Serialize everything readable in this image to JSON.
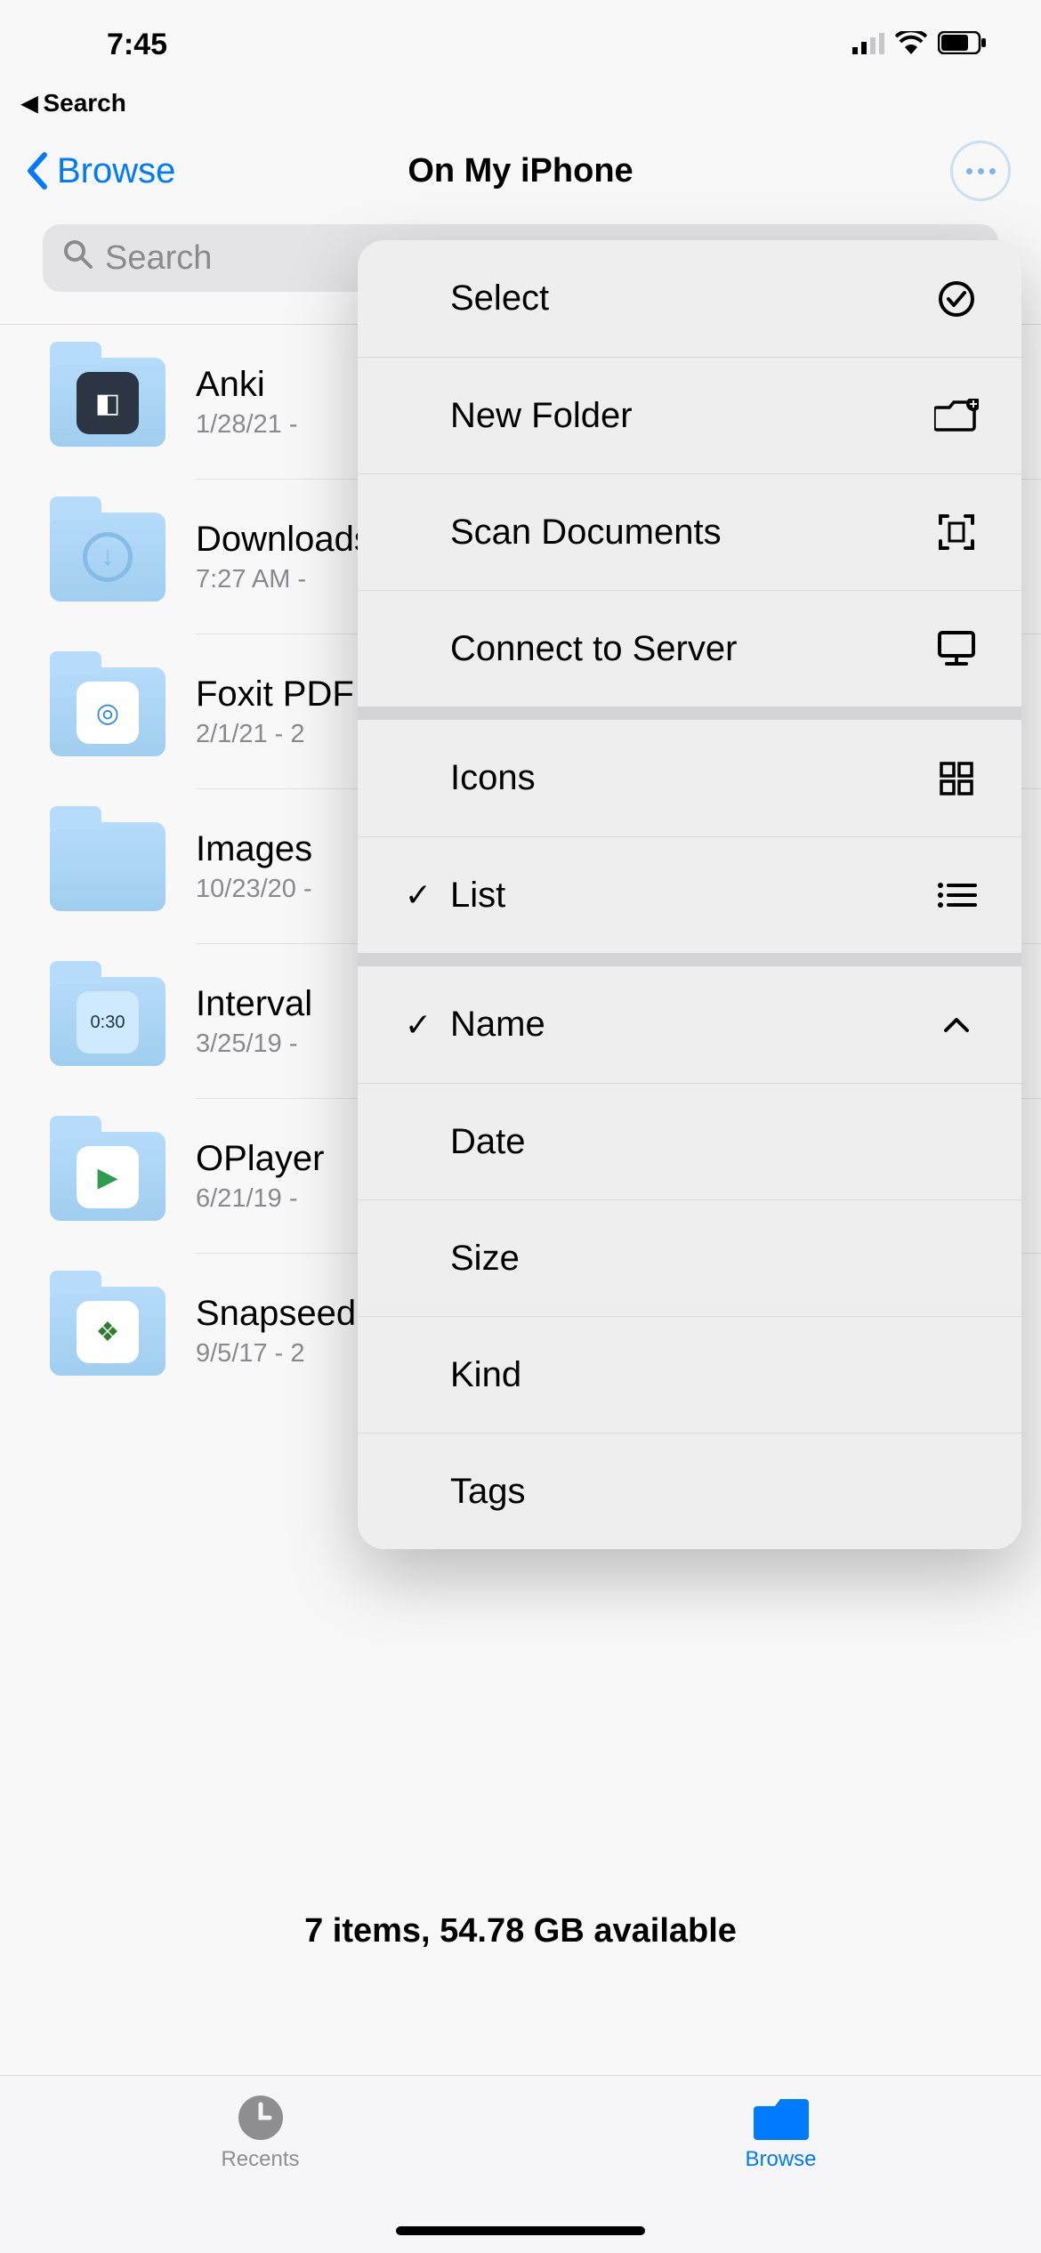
{
  "status": {
    "time": "7:45"
  },
  "back_app_label": "Search",
  "nav": {
    "back_label": "Browse",
    "title": "On My iPhone"
  },
  "search_placeholder": "Search",
  "files": [
    {
      "name": "Anki",
      "sub": "1/28/21 -",
      "variant": "anki"
    },
    {
      "name": "Downloads",
      "sub": "7:27 AM -",
      "variant": "downloads"
    },
    {
      "name": "Foxit PDF",
      "sub": "2/1/21 - 2",
      "variant": "foxit"
    },
    {
      "name": "Images",
      "sub": "10/23/20 -",
      "variant": "plain"
    },
    {
      "name": "Interval",
      "sub": "3/25/19 -",
      "variant": "interval"
    },
    {
      "name": "OPlayer",
      "sub": "6/21/19 -",
      "variant": "oplayer"
    },
    {
      "name": "Snapseed",
      "sub": "9/5/17 - 2",
      "variant": "snapseed"
    }
  ],
  "summary": "7 items, 54.78 GB available",
  "tabbar": {
    "recents": "Recents",
    "browse": "Browse"
  },
  "menu": {
    "select": "Select",
    "new_folder": "New Folder",
    "scan_documents": "Scan Documents",
    "connect_server": "Connect to Server",
    "icons": "Icons",
    "list": "List",
    "name": "Name",
    "date": "Date",
    "size": "Size",
    "kind": "Kind",
    "tags": "Tags"
  }
}
